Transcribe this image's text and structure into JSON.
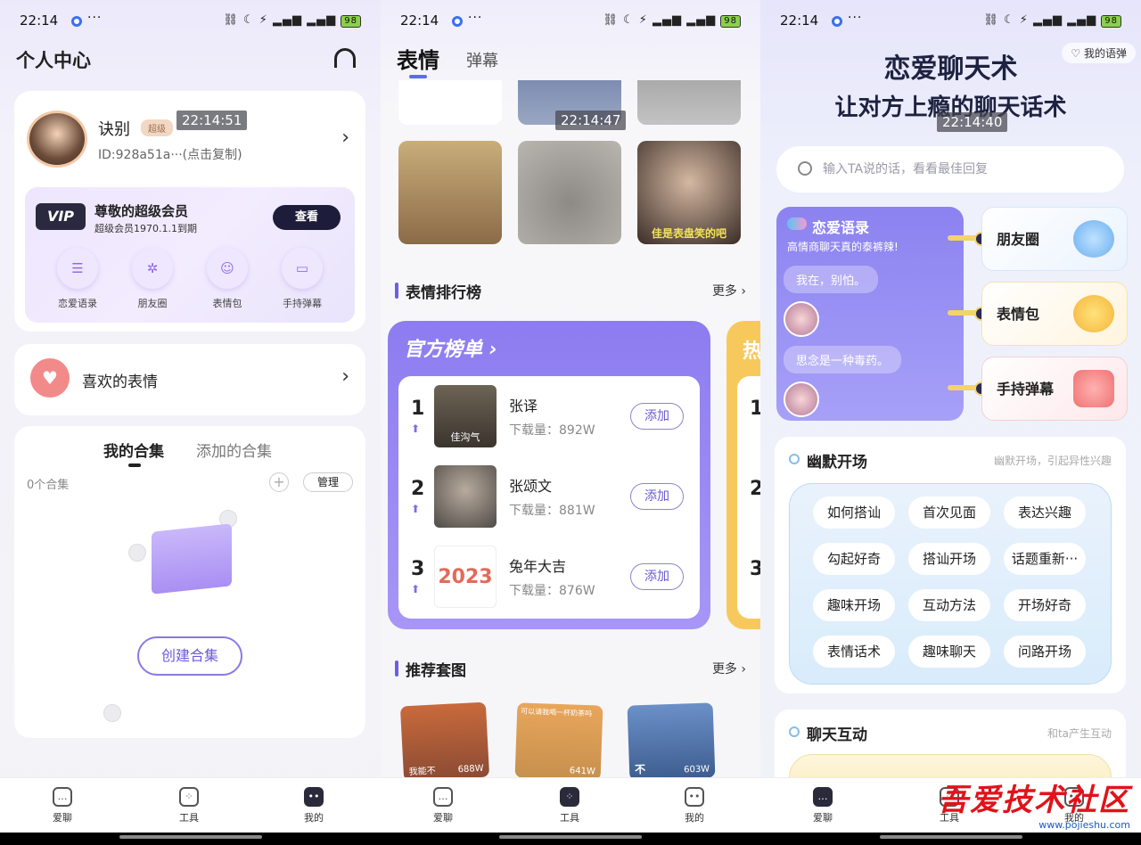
{
  "status": {
    "time": "22:14",
    "battery": "98"
  },
  "panel1": {
    "timestamp": "22:14:51",
    "title": "个人中心",
    "user": {
      "name": "诀别",
      "badge": "超级",
      "id": "ID:928a51a···(点击复制)"
    },
    "vip": {
      "logo": "VIP",
      "title": "尊敬的超级会员",
      "sub": "超级会员1970.1.1到期",
      "btn": "查看",
      "features": [
        "恋爱语录",
        "朋友圈",
        "表情包",
        "手持弹幕"
      ]
    },
    "favorite": "喜欢的表情",
    "collections": {
      "tab1": "我的合集",
      "tab2": "添加的合集",
      "count": "0个合集",
      "manage": "管理",
      "create": "创建合集"
    }
  },
  "panel2": {
    "timestamp": "22:14:47",
    "tabs": [
      "表情",
      "弹幕"
    ],
    "thumb_caption": "佳是表盘笑的吧",
    "ranking_title": "表情排行榜",
    "more": "更多",
    "official": "官方榜单",
    "second_board": "热",
    "items": [
      {
        "rank": "1",
        "name": "张译",
        "downloads": "下载量：892W",
        "add": "添加",
        "img_text": "佳沟气"
      },
      {
        "rank": "2",
        "name": "张颂文",
        "downloads": "下载量：881W",
        "add": "添加",
        "img_text": ""
      },
      {
        "rank": "3",
        "name": "兔年大吉",
        "downloads": "下载量：876W",
        "add": "添加",
        "img_text": "2023"
      }
    ],
    "second_ranks": [
      "1",
      "2",
      "3"
    ],
    "recommend_title": "推荐套图",
    "sets": [
      {
        "caption": "688W",
        "label": "我能不"
      },
      {
        "caption": "641W",
        "label": "可以请我喝一杯奶茶吗"
      },
      {
        "caption": "603W",
        "label": "不"
      }
    ]
  },
  "panel3": {
    "timestamp": "22:14:40",
    "title": "恋爱聊天术",
    "subtitle": "让对方上瘾的聊天话术",
    "my_quotes": "我的语弹",
    "search_placeholder": "输入TA说的话，看看最佳回复",
    "love": {
      "title": "恋爱语录",
      "sub": "高情商聊天真的泰裤辣!",
      "b1": "我在，别怕。",
      "b2": "思念是一种毒药。"
    },
    "side": [
      "朋友圈",
      "表情包",
      "手持弹幕"
    ],
    "humor": {
      "title": "幽默开场",
      "sub": "幽默开场，引起异性兴趣",
      "pills": [
        "如何搭讪",
        "首次见面",
        "表达兴趣",
        "勾起好奇",
        "搭讪开场",
        "话题重新···",
        "趣味开场",
        "互动方法",
        "开场好奇",
        "表情话术",
        "趣味聊天",
        "问路开场"
      ]
    },
    "chat": {
      "title": "聊天互动",
      "sub": "和ta产生互动"
    }
  },
  "nav": [
    "爱聊",
    "工具",
    "我的"
  ],
  "watermark": {
    "main": "吾爱技术社区",
    "sub": "www.pojieshu.com"
  },
  "colors": {
    "accent": "#6b5ee8",
    "vip_dark": "#1d1d3b",
    "rank_purple": "#8d7cf0",
    "rank_yellow": "#f7c95d",
    "watermark": "#e0131a"
  }
}
